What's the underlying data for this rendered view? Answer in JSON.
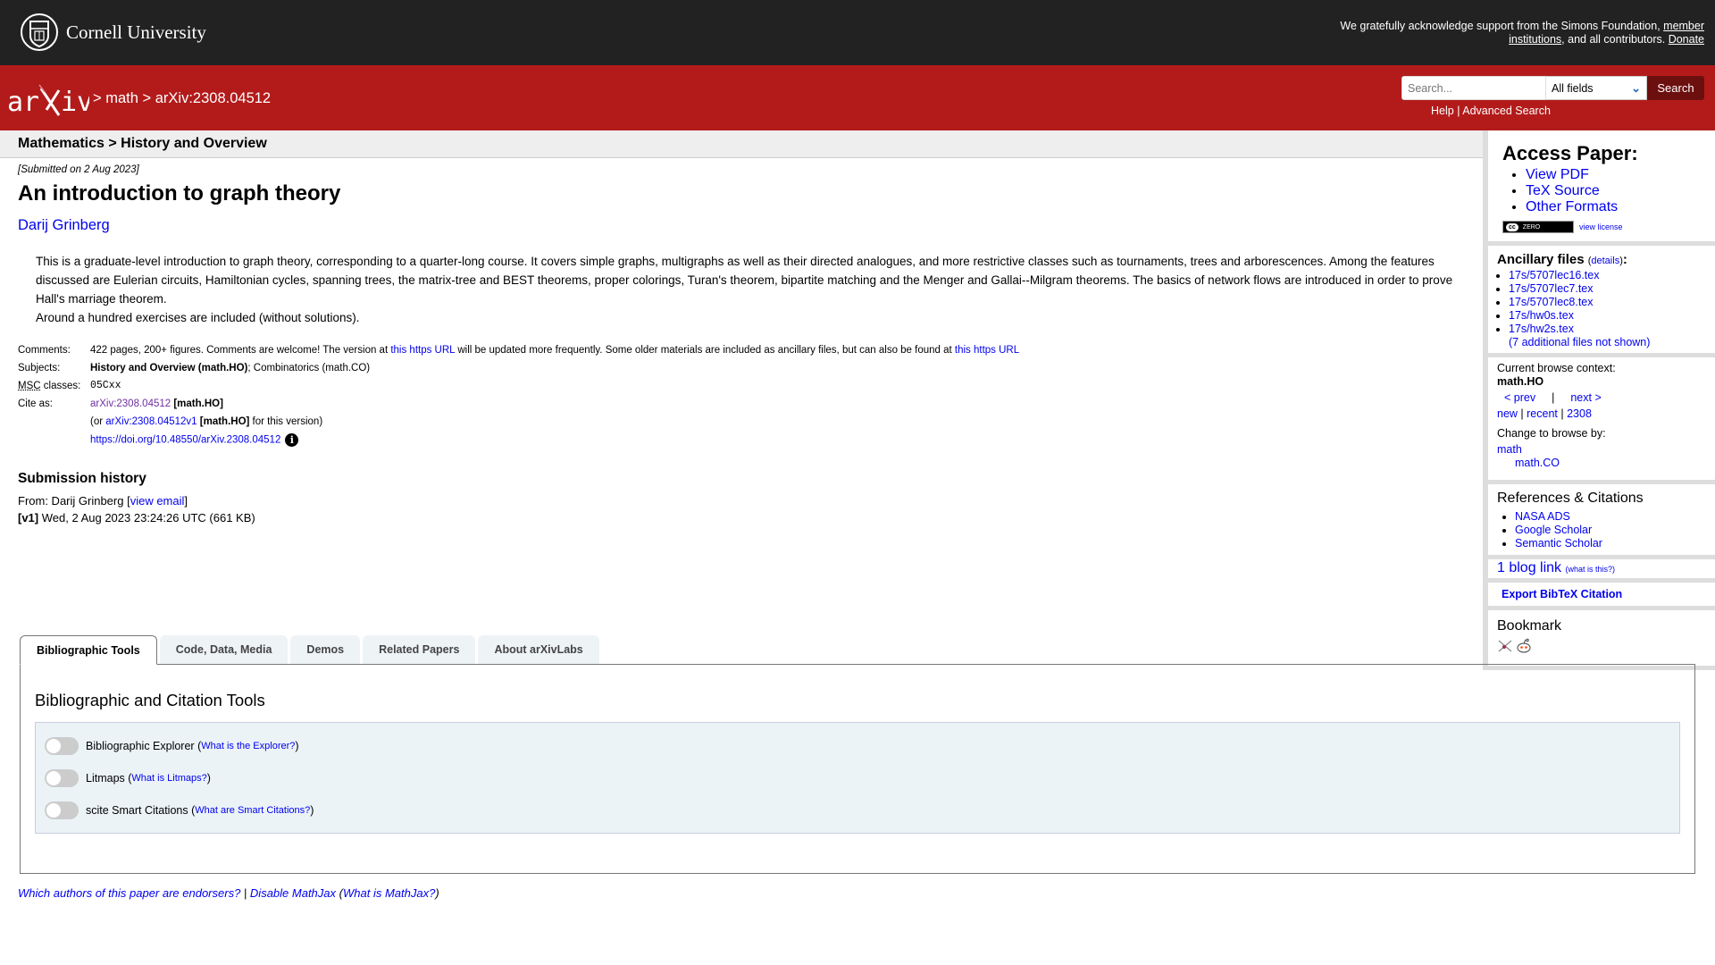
{
  "cornell": {
    "name": "Cornell University",
    "support_text_1": "We gratefully acknowledge support from the Simons Foundation, ",
    "member_institutions": "member institutions",
    "support_text_2": ", and all contributors. ",
    "donate": "Donate"
  },
  "arxiv_header": {
    "logo_text": "arXiv",
    "crumb_sep": ">",
    "crumb_1": "math",
    "crumb_2": "arXiv:2308.04512",
    "search_placeholder": "Search...",
    "search_value": "",
    "field_select": "All fields",
    "search_button": "Search",
    "help": "Help",
    "help_sep": " | ",
    "advanced_search": "Advanced Search"
  },
  "subheader": "Mathematics > History and Overview",
  "paper": {
    "dateline": "[Submitted on 2 Aug 2023]",
    "title": "An introduction to graph theory",
    "author": "Darij Grinberg",
    "abstract_p1": "This is a graduate-level introduction to graph theory, corresponding to a quarter-long course. It covers simple graphs, multigraphs as well as their directed analogues, and more restrictive classes such as tournaments, trees and arborescences. Among the features discussed are Eulerian circuits, Hamiltonian cycles, spanning trees, the matrix-tree and BEST theorems, proper colorings, Turan's theorem, bipartite matching and the Menger and Gallai--Milgram theorems. The basics of network flows are introduced in order to prove Hall's marriage theorem.",
    "abstract_p2": "Around a hundred exercises are included (without solutions).",
    "meta": {
      "comments_label": "Comments:",
      "comments_1": "422 pages, 200+ figures. Comments are welcome! The version at ",
      "comments_link_1": "this https URL",
      "comments_2": " will be updated more frequently. Some older materials are included as ancillary files, but can also be found at ",
      "comments_link_2": "this https URL",
      "subjects_label": "Subjects:",
      "subject_primary": "History and Overview (math.HO)",
      "subject_rest": "; Combinatorics (math.CO)",
      "msc_abbr": "MSC",
      "msc_label_rest": " classes:",
      "msc_value": "05Cxx",
      "cite_label": "Cite as:",
      "cite_id": "arXiv:2308.04512",
      "cite_cat": " [math.HO]",
      "cite_or": "(or ",
      "cite_v1": "arXiv:2308.04512v1",
      "cite_v1_cat": " [math.HO]",
      "cite_v1_rest": " for this version)",
      "doi": "https://doi.org/10.48550/arXiv.2308.04512",
      "info_icon": "i"
    },
    "history": {
      "heading": "Submission history",
      "from": "From: Darij Grinberg [",
      "view_email": "view email",
      "from_end": "]",
      "v1_label": "[v1]",
      "v1_text": " Wed, 2 Aug 2023 23:24:26 UTC (661 KB)"
    }
  },
  "sidebar": {
    "access_title": "Access Paper:",
    "access_links": [
      "View PDF",
      "TeX Source",
      "Other Formats"
    ],
    "license_badge": "ZERO",
    "view_license": "view license",
    "ancillary_title": "Ancillary files",
    "ancillary_details": "details",
    "ancillary_files": [
      "17s/5707lec16.tex",
      "17s/5707lec7.tex",
      "17s/5707lec8.tex",
      "17s/hw0s.tex",
      "17s/hw2s.tex"
    ],
    "ancillary_more": "(7 additional files not shown)",
    "browse_context_label": "Current browse context:",
    "browse_context": "math.HO",
    "prev": "< prev",
    "next": "next >",
    "pn_sep": "|",
    "new": "new",
    "recent": "recent",
    "month": "2308",
    "change_browse": "Change to browse by:",
    "browse_math": "math",
    "browse_math_co": "math.CO",
    "refs_title": "References & Citations",
    "refs": [
      "NASA ADS",
      "Google Scholar",
      "Semantic Scholar"
    ],
    "blog_link": "1 blog link",
    "blog_what": "(what is this?)",
    "export_bibtex": "Export BibTeX Citation",
    "bookmark_title": "Bookmark"
  },
  "labs": {
    "tabs": [
      "Bibliographic Tools",
      "Code, Data, Media",
      "Demos",
      "Related Papers",
      "About arXivLabs"
    ],
    "active_tab": "Bibliographic Tools",
    "panel_title": "Bibliographic and Citation Tools",
    "tools": [
      {
        "label": "Bibliographic Explorer",
        "help": "What is the Explorer?",
        "enabled": false
      },
      {
        "label": "Litmaps",
        "help": "What is Litmaps?",
        "enabled": false
      },
      {
        "label": "scite Smart Citations",
        "help": "What are Smart Citations?",
        "enabled": false
      }
    ]
  },
  "footer": {
    "endorsers": "Which authors of this paper are endorsers?",
    "sep": " | ",
    "disable_mathjax": "Disable MathJax",
    "what_mathjax": "What is MathJax?"
  }
}
